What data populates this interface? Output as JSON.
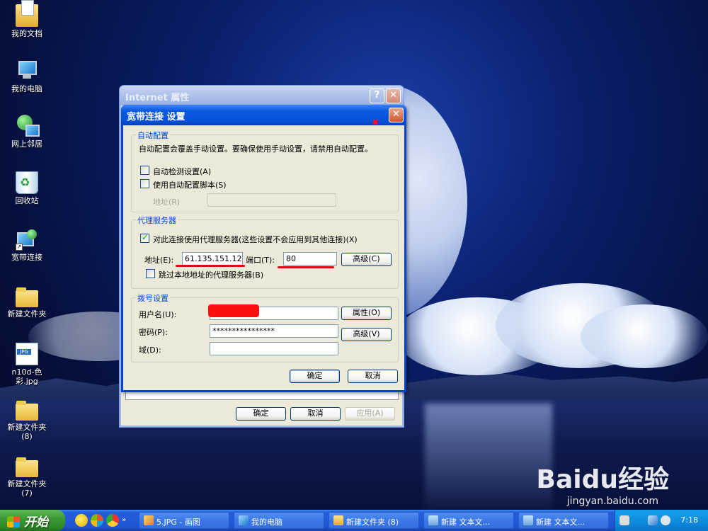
{
  "desktop": {
    "icons": [
      {
        "label": "我的文档"
      },
      {
        "label": "我的电脑"
      },
      {
        "label": "网上邻居"
      },
      {
        "label": "回收站"
      },
      {
        "label": "宽带连接"
      },
      {
        "label": "新建文件夹"
      },
      {
        "label": "n10d-色彩.jpg"
      },
      {
        "label": "新建文件夹 (8)"
      },
      {
        "label": "新建文件夹 (7)"
      }
    ]
  },
  "back_window": {
    "title": "Internet 属性",
    "ok": "确定",
    "cancel": "取消",
    "apply": "应用(A)"
  },
  "dialog": {
    "title": "宽带连接 设置",
    "auto_config": {
      "legend": "自动配置",
      "desc": "自动配置会覆盖手动设置。要确保使用手动设置，请禁用自动配置。",
      "auto_detect": "自动检测设置(A)",
      "use_script": "使用自动配置脚本(S)",
      "address_label": "地址(R)",
      "address_value": ""
    },
    "proxy": {
      "legend": "代理服务器",
      "use_proxy": "对此连接使用代理服务器(这些设置不会应用到其他连接)(X)",
      "address_label": "地址(E):",
      "address_value": "61.135.151.122",
      "port_label": "端口(T):",
      "port_value": "80",
      "advanced": "高级(C)",
      "bypass_local": "跳过本地地址的代理服务器(B)"
    },
    "dialup": {
      "legend": "拨号设置",
      "username_label": "用户名(U):",
      "username_value": "",
      "properties": "属性(O)",
      "password_label": "密码(P):",
      "password_value": "****************",
      "advanced": "高级(V)",
      "domain_label": "域(D):",
      "domain_value": ""
    },
    "ok": "确定",
    "cancel": "取消"
  },
  "taskbar": {
    "start": "开始",
    "tasks": [
      {
        "label": "5.JPG - 画图"
      },
      {
        "label": "我的电脑"
      },
      {
        "label": "新建文件夹 (8)"
      },
      {
        "label": "新建 文本文..."
      },
      {
        "label": "新建 文本文..."
      }
    ],
    "clock": "7:18"
  },
  "watermark": {
    "brand": "Baidu经验",
    "url": "jingyan.baidu.com"
  }
}
